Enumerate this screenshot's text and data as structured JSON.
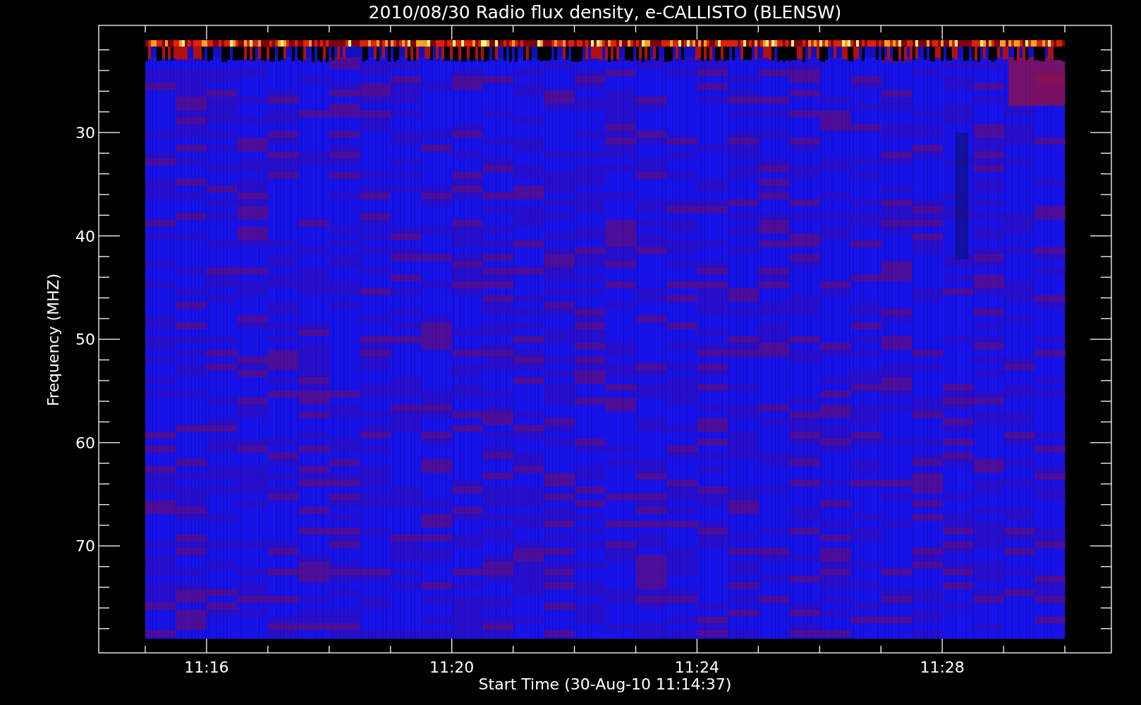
{
  "title": "2010/08/30  Radio flux density, e-CALLISTO (BLENSW)",
  "y_axis": {
    "label": "Frequency (MHZ)",
    "ticks": [
      "30",
      "40",
      "50",
      "60",
      "70"
    ]
  },
  "x_axis": {
    "label": "Start Time (30-Aug-10 11:14:37)",
    "ticks": [
      "11:16",
      "11:20",
      "11:24",
      "11:28"
    ]
  }
}
